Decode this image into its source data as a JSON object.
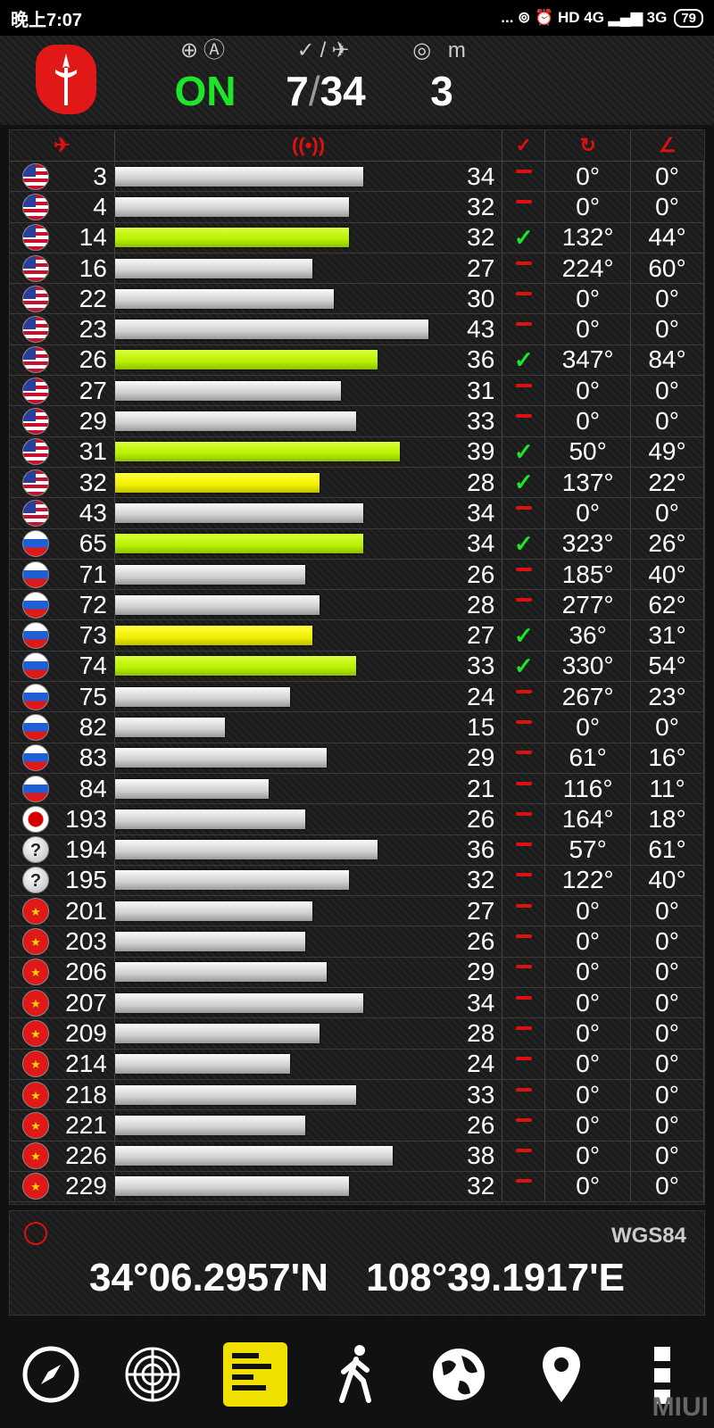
{
  "status_bar": {
    "time": "晚上7:07",
    "indicators": "... ⊚ ⏰ HD 4G ▂▄▆ 3G",
    "battery": "79"
  },
  "header": {
    "fix_status": "ON",
    "sats_used": "7",
    "sats_separator": "/",
    "sats_total": "34",
    "accuracy_label": "m",
    "accuracy_value": "3"
  },
  "table": {
    "columns": [
      "satellite-icon",
      "signal-icon",
      "used-check-icon",
      "azimuth-icon",
      "elevation-icon"
    ],
    "snr_scale_max": 52,
    "rows": [
      {
        "c": "us",
        "prn": "3",
        "snr": "34",
        "used": false,
        "az": "0°",
        "el": "0°",
        "bar": "grey"
      },
      {
        "c": "us",
        "prn": "4",
        "snr": "32",
        "used": false,
        "az": "0°",
        "el": "0°",
        "bar": "grey"
      },
      {
        "c": "us",
        "prn": "14",
        "snr": "32",
        "used": true,
        "az": "132°",
        "el": "44°",
        "bar": "lime"
      },
      {
        "c": "us",
        "prn": "16",
        "snr": "27",
        "used": false,
        "az": "224°",
        "el": "60°",
        "bar": "grey"
      },
      {
        "c": "us",
        "prn": "22",
        "snr": "30",
        "used": false,
        "az": "0°",
        "el": "0°",
        "bar": "grey"
      },
      {
        "c": "us",
        "prn": "23",
        "snr": "43",
        "used": false,
        "az": "0°",
        "el": "0°",
        "bar": "grey"
      },
      {
        "c": "us",
        "prn": "26",
        "snr": "36",
        "used": true,
        "az": "347°",
        "el": "84°",
        "bar": "lime"
      },
      {
        "c": "us",
        "prn": "27",
        "snr": "31",
        "used": false,
        "az": "0°",
        "el": "0°",
        "bar": "grey"
      },
      {
        "c": "us",
        "prn": "29",
        "snr": "33",
        "used": false,
        "az": "0°",
        "el": "0°",
        "bar": "grey"
      },
      {
        "c": "us",
        "prn": "31",
        "snr": "39",
        "used": true,
        "az": "50°",
        "el": "49°",
        "bar": "lime"
      },
      {
        "c": "us",
        "prn": "32",
        "snr": "28",
        "used": true,
        "az": "137°",
        "el": "22°",
        "bar": "yellow"
      },
      {
        "c": "us",
        "prn": "43",
        "snr": "34",
        "used": false,
        "az": "0°",
        "el": "0°",
        "bar": "grey"
      },
      {
        "c": "ru",
        "prn": "65",
        "snr": "34",
        "used": true,
        "az": "323°",
        "el": "26°",
        "bar": "lime"
      },
      {
        "c": "ru",
        "prn": "71",
        "snr": "26",
        "used": false,
        "az": "185°",
        "el": "40°",
        "bar": "grey"
      },
      {
        "c": "ru",
        "prn": "72",
        "snr": "28",
        "used": false,
        "az": "277°",
        "el": "62°",
        "bar": "grey"
      },
      {
        "c": "ru",
        "prn": "73",
        "snr": "27",
        "used": true,
        "az": "36°",
        "el": "31°",
        "bar": "yellow"
      },
      {
        "c": "ru",
        "prn": "74",
        "snr": "33",
        "used": true,
        "az": "330°",
        "el": "54°",
        "bar": "lime"
      },
      {
        "c": "ru",
        "prn": "75",
        "snr": "24",
        "used": false,
        "az": "267°",
        "el": "23°",
        "bar": "grey"
      },
      {
        "c": "ru",
        "prn": "82",
        "snr": "15",
        "used": false,
        "az": "0°",
        "el": "0°",
        "bar": "grey"
      },
      {
        "c": "ru",
        "prn": "83",
        "snr": "29",
        "used": false,
        "az": "61°",
        "el": "16°",
        "bar": "grey"
      },
      {
        "c": "ru",
        "prn": "84",
        "snr": "21",
        "used": false,
        "az": "116°",
        "el": "11°",
        "bar": "grey"
      },
      {
        "c": "jp",
        "prn": "193",
        "snr": "26",
        "used": false,
        "az": "164°",
        "el": "18°",
        "bar": "grey"
      },
      {
        "c": "un",
        "prn": "194",
        "snr": "36",
        "used": false,
        "az": "57°",
        "el": "61°",
        "bar": "grey"
      },
      {
        "c": "un",
        "prn": "195",
        "snr": "32",
        "used": false,
        "az": "122°",
        "el": "40°",
        "bar": "grey"
      },
      {
        "c": "cn",
        "prn": "201",
        "snr": "27",
        "used": false,
        "az": "0°",
        "el": "0°",
        "bar": "grey"
      },
      {
        "c": "cn",
        "prn": "203",
        "snr": "26",
        "used": false,
        "az": "0°",
        "el": "0°",
        "bar": "grey"
      },
      {
        "c": "cn",
        "prn": "206",
        "snr": "29",
        "used": false,
        "az": "0°",
        "el": "0°",
        "bar": "grey"
      },
      {
        "c": "cn",
        "prn": "207",
        "snr": "34",
        "used": false,
        "az": "0°",
        "el": "0°",
        "bar": "grey"
      },
      {
        "c": "cn",
        "prn": "209",
        "snr": "28",
        "used": false,
        "az": "0°",
        "el": "0°",
        "bar": "grey"
      },
      {
        "c": "cn",
        "prn": "214",
        "snr": "24",
        "used": false,
        "az": "0°",
        "el": "0°",
        "bar": "grey"
      },
      {
        "c": "cn",
        "prn": "218",
        "snr": "33",
        "used": false,
        "az": "0°",
        "el": "0°",
        "bar": "grey"
      },
      {
        "c": "cn",
        "prn": "221",
        "snr": "26",
        "used": false,
        "az": "0°",
        "el": "0°",
        "bar": "grey"
      },
      {
        "c": "cn",
        "prn": "226",
        "snr": "38",
        "used": false,
        "az": "0°",
        "el": "0°",
        "bar": "grey"
      },
      {
        "c": "cn",
        "prn": "229",
        "snr": "32",
        "used": false,
        "az": "0°",
        "el": "0°",
        "bar": "grey"
      }
    ]
  },
  "footer": {
    "datum": "WGS84",
    "latitude": "34°06.2957'N",
    "longitude": "108°39.1917'E"
  },
  "navbar": {
    "items": [
      "compass-icon",
      "radar-icon",
      "signal-bars-icon",
      "walk-icon",
      "globe-icon",
      "map-pin-icon",
      "more-icon"
    ],
    "active": "signal-bars-icon"
  },
  "watermark": "MIUI",
  "colors": {
    "accent_red": "#e01010",
    "on_green": "#1de52a",
    "bar_lime": "#b7f000",
    "bar_yellow": "#f0f000",
    "bar_grey": "#cfcfcf"
  }
}
